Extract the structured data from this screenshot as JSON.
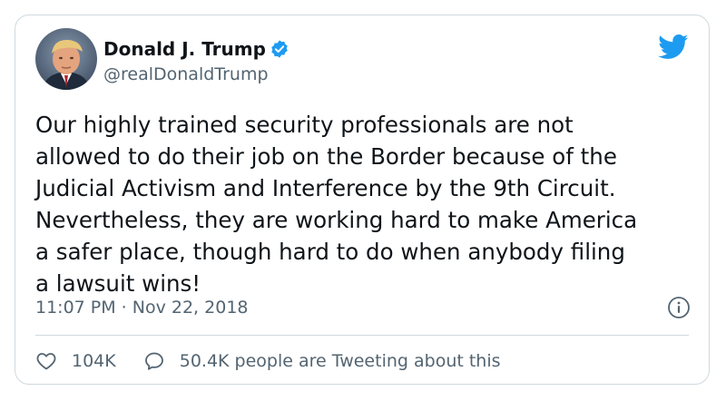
{
  "author": {
    "name": "Donald J. Trump",
    "handle": "@realDonaldTrump",
    "verified": true
  },
  "tweet": {
    "lines": [
      "Our highly trained security professionals are not",
      "allowed to do their job on the Border because of the",
      "Judicial Activism and Interference by the 9th Circuit.",
      "Nevertheless, they are working hard to make America",
      "a safer place, though hard to do when anybody filing",
      "a lawsuit wins!"
    ],
    "timestamp": "11:07 PM · Nov 22, 2018"
  },
  "actions": {
    "likes": "104K",
    "replies_label": "50.4K people are Tweeting about this"
  },
  "colors": {
    "brand": "#1d9bf0",
    "text": "#0f1419",
    "muted": "#536471",
    "border": "#cfd9de"
  },
  "icons": [
    "verified-badge-icon",
    "twitter-bird-icon",
    "info-icon",
    "heart-icon",
    "speech-bubble-icon"
  ]
}
